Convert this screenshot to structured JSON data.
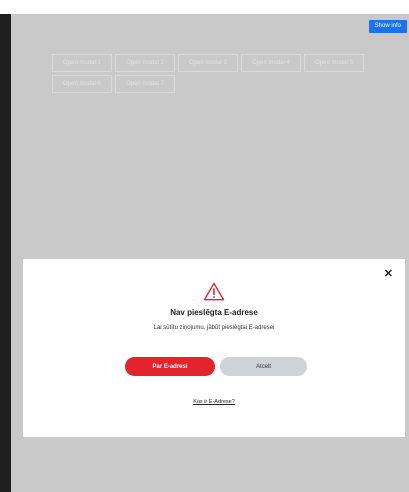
{
  "toolbar": {
    "show_info": "Show info"
  },
  "modal_buttons": [
    "Open modal 1",
    "Open modal 2",
    "Open modal 3",
    "Open modal 4",
    "Open modal 5",
    "Open modal 6",
    "Open modal 7"
  ],
  "dialog": {
    "title": "Nav pieslēgta E-adrese",
    "message": "Lai sūtītu ziņojumu, jābūt pieslēgtai E-adresei",
    "primary_label": "Par E-adresi",
    "secondary_label": "Atcelt",
    "link_text": "Kas ir E-Adrese?",
    "close_glyph": "✕"
  },
  "colors": {
    "primary": "#e3232d",
    "secondary": "#cfd2d6",
    "show_info": "#1a73e8",
    "warning_icon": "#e3232d"
  },
  "icons": {
    "warning": "warning-triangle-icon",
    "close": "close-icon"
  }
}
